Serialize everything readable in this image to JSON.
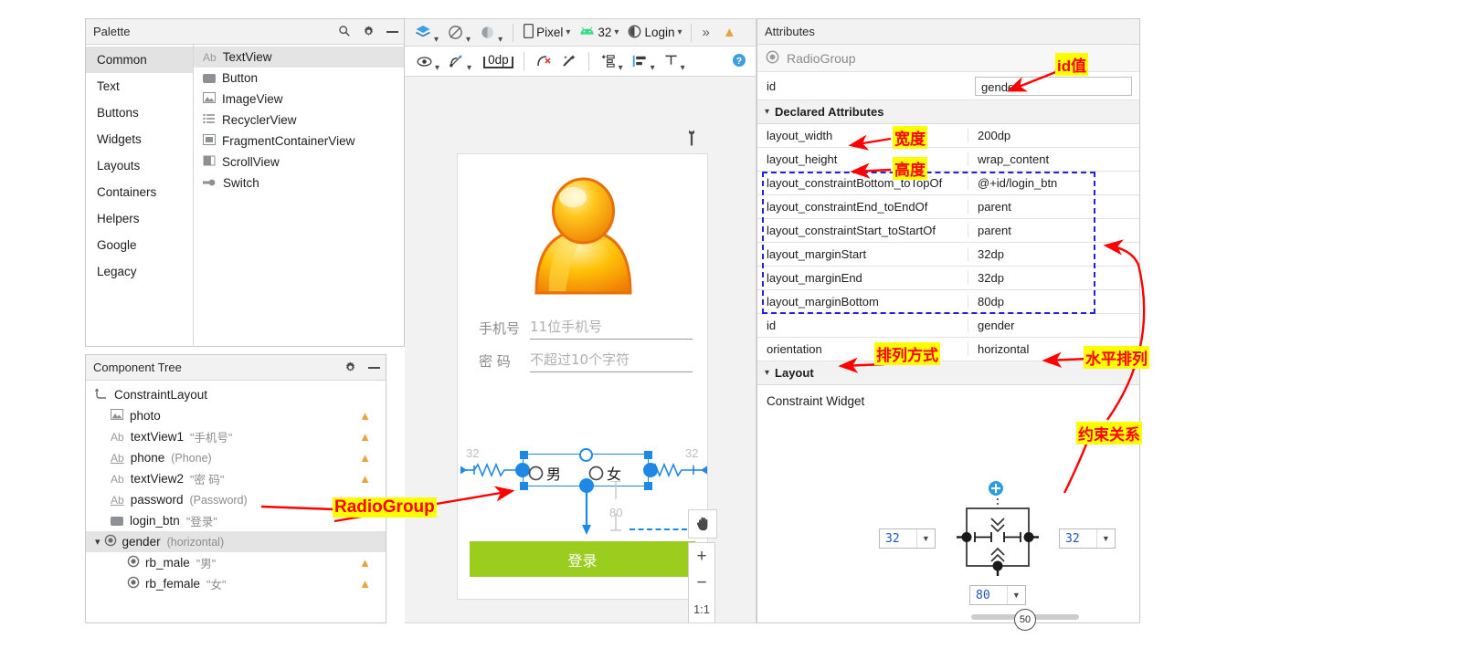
{
  "palette": {
    "title": "Palette",
    "icons": [
      "search-icon",
      "gear-icon",
      "minimize-icon"
    ],
    "categories": [
      {
        "label": "Common",
        "selected": true
      },
      {
        "label": "Text",
        "selected": false
      },
      {
        "label": "Buttons",
        "selected": false
      },
      {
        "label": "Widgets",
        "selected": false
      },
      {
        "label": "Layouts",
        "selected": false
      },
      {
        "label": "Containers",
        "selected": false
      },
      {
        "label": "Helpers",
        "selected": false
      },
      {
        "label": "Google",
        "selected": false
      },
      {
        "label": "Legacy",
        "selected": false
      }
    ],
    "items": [
      {
        "label": "TextView",
        "icon": "ab-icon",
        "selected": true
      },
      {
        "label": "Button",
        "icon": "button-icon",
        "selected": false
      },
      {
        "label": "ImageView",
        "icon": "image-icon",
        "selected": false
      },
      {
        "label": "RecyclerView",
        "icon": "list-icon",
        "selected": false
      },
      {
        "label": "FragmentContainerView",
        "icon": "fragment-icon",
        "selected": false
      },
      {
        "label": "ScrollView",
        "icon": "scrollview-icon",
        "selected": false
      },
      {
        "label": "Switch",
        "icon": "switch-icon",
        "selected": false
      }
    ]
  },
  "component_tree": {
    "title": "Component Tree",
    "icons": [
      "gear-icon",
      "minimize-icon"
    ],
    "nodes": [
      {
        "name": "ConstraintLayout",
        "sub": "",
        "icon": "constraintlayout-icon",
        "indent": 0,
        "warn": false,
        "selected": false
      },
      {
        "name": "photo",
        "sub": "",
        "icon": "image-icon",
        "indent": 1,
        "warn": true,
        "selected": false
      },
      {
        "name": "textView1",
        "sub": "\"手机号\"",
        "icon": "ab-icon",
        "indent": 1,
        "warn": true,
        "selected": false
      },
      {
        "name": "phone",
        "sub": "(Phone)",
        "icon": "ab-underline-icon",
        "indent": 1,
        "warn": true,
        "selected": false
      },
      {
        "name": "textView2",
        "sub": "\"密  码\"",
        "icon": "ab-icon",
        "indent": 1,
        "warn": true,
        "selected": false
      },
      {
        "name": "password",
        "sub": "(Password)",
        "icon": "ab-underline-icon",
        "indent": 1,
        "warn": true,
        "selected": false
      },
      {
        "name": "login_btn",
        "sub": "\"登录\"",
        "icon": "button-icon",
        "indent": 1,
        "warn": false,
        "selected": false
      },
      {
        "name": "gender",
        "sub": "(horizontal)",
        "icon": "radiogroup-icon",
        "indent": 1,
        "warn": false,
        "selected": true,
        "expanded": true
      },
      {
        "name": "rb_male",
        "sub": "\"男\"",
        "icon": "radiobutton-icon",
        "indent": 2,
        "warn": true,
        "selected": false
      },
      {
        "name": "rb_female",
        "sub": "\"女\"",
        "icon": "radiobutton-icon",
        "indent": 2,
        "warn": true,
        "selected": false
      }
    ]
  },
  "toolbar": {
    "design_mode_icon": "layers-icon",
    "blueprint_icon": "blueprint-icon",
    "theme_icon": "theme-icon",
    "device": "Pixel",
    "device_icon": "phone-icon",
    "api_level": "32",
    "api_icon": "android-icon",
    "theme_name": "Login",
    "theme_name_icon": "contrast-icon",
    "overflow": "»",
    "warning_icon": "warning-icon",
    "row2": {
      "visibility_icon": "eye-icon",
      "constraints_icon": "hide-constraints-icon",
      "margin_value": "0dp",
      "clear_constraints_icon": "clear-constraints-icon",
      "infer_icon": "magic-wand-icon",
      "guidelines_icon": "guidelines-icon",
      "align_icon": "align-icon",
      "baseline_icon": "baseline-icon",
      "help_icon": "help-icon"
    }
  },
  "canvas": {
    "wrench_icon": "wrench-icon",
    "phone_label": "手机号",
    "phone_placeholder": "11位手机号",
    "password_label": "密  码",
    "password_placeholder": "不超过10个字符",
    "radio_male": "男",
    "radio_female": "女",
    "login_button": "登录",
    "login_button_color": "#9ACD1E",
    "margin_left": "32",
    "margin_right": "32",
    "margin_bottom": "80",
    "selection_color": "#1e88e5",
    "zoom_controls": {
      "pan_icon": "hand-icon",
      "zoom_in": "+",
      "zoom_out": "−",
      "zoom_fit": "1:1"
    }
  },
  "attributes": {
    "title": "Attributes",
    "widget_type": "RadioGroup",
    "widget_icon": "radiogroup-icon",
    "id_key": "id",
    "id_value": "gender",
    "declared_section": "Declared Attributes",
    "rows": [
      {
        "key": "layout_width",
        "value": "200dp",
        "boxed": false
      },
      {
        "key": "layout_height",
        "value": "wrap_content",
        "boxed": false
      },
      {
        "key": "layout_constraintBottom_toTopOf",
        "value": "@+id/login_btn",
        "boxed": true
      },
      {
        "key": "layout_constraintEnd_toEndOf",
        "value": "parent",
        "boxed": true
      },
      {
        "key": "layout_constraintStart_toStartOf",
        "value": "parent",
        "boxed": true
      },
      {
        "key": "layout_marginStart",
        "value": "32dp",
        "boxed": true
      },
      {
        "key": "layout_marginEnd",
        "value": "32dp",
        "boxed": true
      },
      {
        "key": "layout_marginBottom",
        "value": "80dp",
        "boxed": true
      },
      {
        "key": "id",
        "value": "gender",
        "boxed": false
      },
      {
        "key": "orientation",
        "value": "horizontal",
        "boxed": false
      }
    ],
    "layout_section": "Layout",
    "constraint_widget_label": "Constraint Widget",
    "constraint_widget": {
      "left_margin": "32",
      "right_margin": "32",
      "bottom_margin": "80",
      "bias": "50",
      "add_icon": "add-constraint-icon"
    }
  },
  "annotations": [
    {
      "text": "id值",
      "name": "annotation-id-value"
    },
    {
      "text": "宽度",
      "name": "annotation-width"
    },
    {
      "text": "高度",
      "name": "annotation-height"
    },
    {
      "text": "排列方式",
      "name": "annotation-orientation"
    },
    {
      "text": "水平排列",
      "name": "annotation-horizontal"
    },
    {
      "text": "约束关系",
      "name": "annotation-constraints"
    },
    {
      "text": "RadioGroup",
      "name": "annotation-radiogroup"
    }
  ]
}
